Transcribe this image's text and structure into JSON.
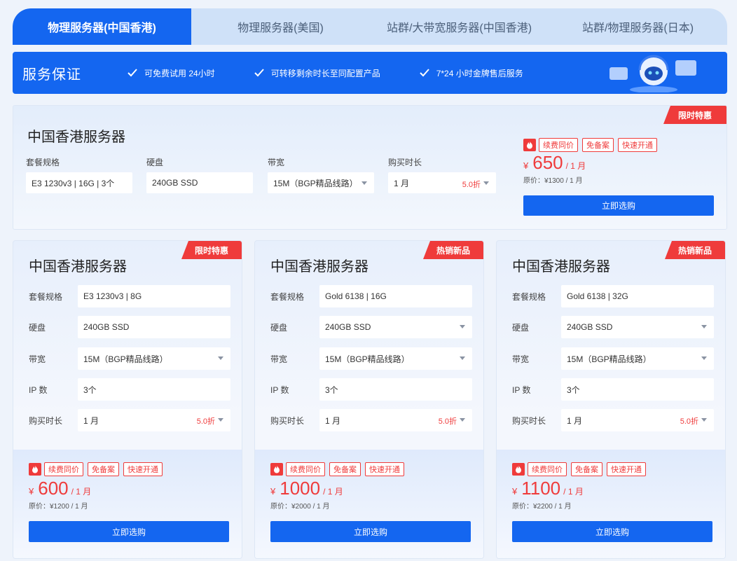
{
  "tabs": [
    "物理服务器(中国香港)",
    "物理服务器(美国)",
    "站群/大带宽服务器(中国香港)",
    "站群/物理服务器(日本)"
  ],
  "service": {
    "title": "服务保证",
    "items": [
      "可免费试用 24小时",
      "可转移剩余时长至同配置产品",
      "7*24 小时金牌售后服务"
    ]
  },
  "featured": {
    "ribbon": "限时特惠",
    "title": "中国香港服务器",
    "labels": {
      "spec": "套餐规格",
      "disk": "硬盘",
      "bw": "带宽",
      "duration": "购买时长"
    },
    "values": {
      "spec": "E3 1230v3 | 16G | 3个",
      "disk": "240GB SSD",
      "bw": "15M（BGP精品线路）",
      "duration": "1 月",
      "discount": "5.0折"
    },
    "tags": [
      "续费同价",
      "免备案",
      "快速开通"
    ],
    "currency": "¥",
    "price": "650",
    "unit": "/ 1 月",
    "original": "原价：¥1300 / 1 月",
    "buy": "立即选购"
  },
  "card_labels": {
    "spec": "套餐规格",
    "disk": "硬盘",
    "bw": "带宽",
    "ip": "IP 数",
    "duration": "购买时长"
  },
  "cards": [
    {
      "ribbon": "限时特惠",
      "title": "中国香港服务器",
      "spec": "E3 1230v3 | 8G",
      "disk": "240GB SSD",
      "bw": "15M（BGP精品线路）",
      "ip": "3个",
      "duration": "1 月",
      "discount": "5.0折",
      "tags": [
        "续费同价",
        "免备案",
        "快速开通"
      ],
      "currency": "¥",
      "price": "600",
      "unit": "/ 1 月",
      "original": "原价：¥1200 / 1 月",
      "buy": "立即选购"
    },
    {
      "ribbon": "热销新品",
      "title": "中国香港服务器",
      "spec": "Gold 6138 | 16G",
      "disk": "240GB SSD",
      "bw": "15M（BGP精品线路）",
      "ip": "3个",
      "duration": "1 月",
      "discount": "5.0折",
      "tags": [
        "续费同价",
        "免备案",
        "快速开通"
      ],
      "currency": "¥",
      "price": "1000",
      "unit": "/ 1 月",
      "original": "原价：¥2000 / 1 月",
      "buy": "立即选购"
    },
    {
      "ribbon": "热销新品",
      "title": "中国香港服务器",
      "spec": "Gold 6138 | 32G",
      "disk": "240GB SSD",
      "bw": "15M（BGP精品线路）",
      "ip": "3个",
      "duration": "1 月",
      "discount": "5.0折",
      "tags": [
        "续费同价",
        "免备案",
        "快速开通"
      ],
      "currency": "¥",
      "price": "1100",
      "unit": "/ 1 月",
      "original": "原价：¥2200 / 1 月",
      "buy": "立即选购"
    }
  ],
  "colors": {
    "accent": "#1466f0",
    "red": "#ef3b3b"
  }
}
